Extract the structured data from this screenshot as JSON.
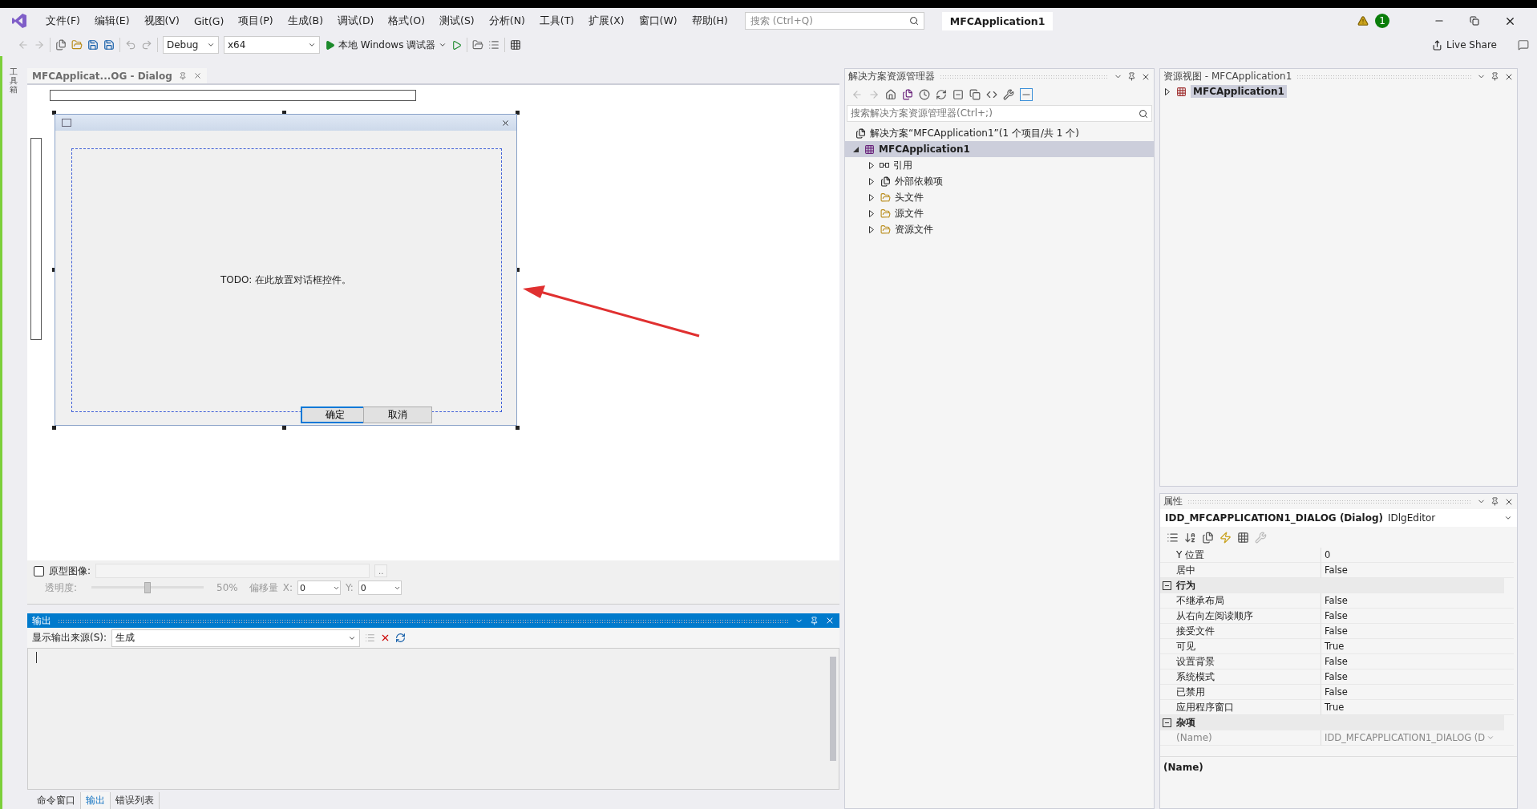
{
  "menu_bar": {
    "items": [
      "文件(F)",
      "编辑(E)",
      "视图(V)",
      "Git(G)",
      "项目(P)",
      "生成(B)",
      "调试(D)",
      "格式(O)",
      "测试(S)",
      "分析(N)",
      "工具(T)",
      "扩展(X)",
      "窗口(W)",
      "帮助(H)"
    ],
    "search": {
      "placeholder": "搜索 (Ctrl+Q)"
    },
    "solution_name": "MFCApplication1",
    "notification_count": "1"
  },
  "toolbar": {
    "configuration": "Debug",
    "platform": "x64",
    "run_label": "本地 Windows 调试器",
    "live_share": "Live Share"
  },
  "left_strip": {
    "label": "工具箱"
  },
  "editor": {
    "tab": {
      "title": "MFCApplicat...OG - Dialog",
      "selected": true
    },
    "dialog": {
      "text": "TODO: 在此放置对话框控件。",
      "buttons": [
        {
          "label": "确定",
          "selected": true
        },
        {
          "label": "取消",
          "selected": false
        }
      ]
    },
    "prototype": {
      "label": "原型图像:",
      "checked": false,
      "browse": "..",
      "opacity": {
        "label": "透明度:",
        "level": 0.5,
        "reading": "50%"
      },
      "offset_label": "偏移量",
      "x_label": "X:",
      "x_value": "0",
      "y_label": "Y:",
      "y_value": "0"
    }
  },
  "output": {
    "title": "输出",
    "source_label": "显示输出来源(S):",
    "source_value": "生成"
  },
  "bottom_tabs": [
    {
      "label": "命令窗口",
      "selected": false
    },
    {
      "label": "输出",
      "selected": true
    },
    {
      "label": "错误列表",
      "selected": false
    }
  ],
  "solution_explorer": {
    "title": "解决方案资源管理器",
    "search": {
      "placeholder": "搜索解决方案资源管理器(Ctrl+;)"
    },
    "tree": [
      {
        "label": "解决方案“MFCApplication1”(1 个项目/共 1 个)",
        "kind": "solution",
        "selected": false,
        "children": [
          {
            "label": "MFCApplication1",
            "kind": "project",
            "expanded": true,
            "selected": true,
            "children": [
              {
                "label": "引用",
                "kind": "references",
                "expanded": false,
                "selected": false
              },
              {
                "label": "外部依赖项",
                "kind": "external",
                "expanded": false,
                "selected": false
              },
              {
                "label": "头文件",
                "kind": "filter",
                "expanded": false,
                "selected": false
              },
              {
                "label": "源文件",
                "kind": "filter",
                "expanded": false,
                "selected": false
              },
              {
                "label": "资源文件",
                "kind": "filter",
                "expanded": false,
                "selected": false
              }
            ]
          }
        ]
      }
    ]
  },
  "resource_view": {
    "title": "资源视图 - MFCApplication1",
    "tree": [
      {
        "label": "MFCApplication1",
        "expanded": false,
        "selected": true
      }
    ]
  },
  "properties": {
    "title": "属性",
    "object": "IDD_MFCAPPLICATION1_DIALOG (Dialog)",
    "object_type": "IDlgEditor",
    "rows": [
      {
        "kind": "property",
        "name": "Y 位置",
        "value": "0",
        "disabled": false
      },
      {
        "kind": "property",
        "name": "居中",
        "value": "False",
        "disabled": false
      },
      {
        "kind": "category",
        "name": "行为",
        "expanded": true
      },
      {
        "kind": "property",
        "name": "不继承布局",
        "value": "False",
        "disabled": false
      },
      {
        "kind": "property",
        "name": "从右向左阅读顺序",
        "value": "False",
        "disabled": false
      },
      {
        "kind": "property",
        "name": "接受文件",
        "value": "False",
        "disabled": false
      },
      {
        "kind": "property",
        "name": "可见",
        "value": "True",
        "disabled": false
      },
      {
        "kind": "property",
        "name": "设置背景",
        "value": "False",
        "disabled": false
      },
      {
        "kind": "property",
        "name": "系统模式",
        "value": "False",
        "disabled": false
      },
      {
        "kind": "property",
        "name": "已禁用",
        "value": "False",
        "disabled": false
      },
      {
        "kind": "property",
        "name": "应用程序窗口",
        "value": "True",
        "disabled": false
      },
      {
        "kind": "category",
        "name": "杂项",
        "expanded": true
      },
      {
        "kind": "property",
        "name": "(Name)",
        "value": "IDD_MFCAPPLICATION1_DIALOG (D",
        "disabled": true
      }
    ],
    "description_title": "(Name)"
  }
}
